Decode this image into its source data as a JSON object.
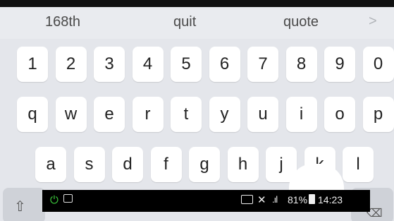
{
  "suggestions": [
    "168th",
    "quit",
    "quote"
  ],
  "suggestion_more_icon": "chevron-right-icon",
  "keyboard": {
    "row1": [
      "1",
      "2",
      "3",
      "4",
      "5",
      "6",
      "7",
      "8",
      "9",
      "0"
    ],
    "row2": [
      "q",
      "w",
      "e",
      "r",
      "t",
      "y",
      "u",
      "i",
      "o",
      "p"
    ],
    "row3": [
      "a",
      "s",
      "d",
      "f",
      "g",
      "h",
      "j",
      "k",
      "l"
    ],
    "shift_icon": "shift-icon",
    "delete_icon": "backspace-icon"
  },
  "status_bar": {
    "battery": "81%",
    "time": "14:23",
    "left_icons": [
      "power-icon",
      "cast-notification-icon"
    ],
    "right_icons": [
      "screen-cast-icon",
      "mute-icon",
      "signal-icon",
      "battery-icon"
    ]
  },
  "colors": {
    "keyboard_bg": "#e4e6eb",
    "key_bg": "#ffffff",
    "status_bar_bg": "#000000",
    "power_icon": "#3ecf3e"
  }
}
